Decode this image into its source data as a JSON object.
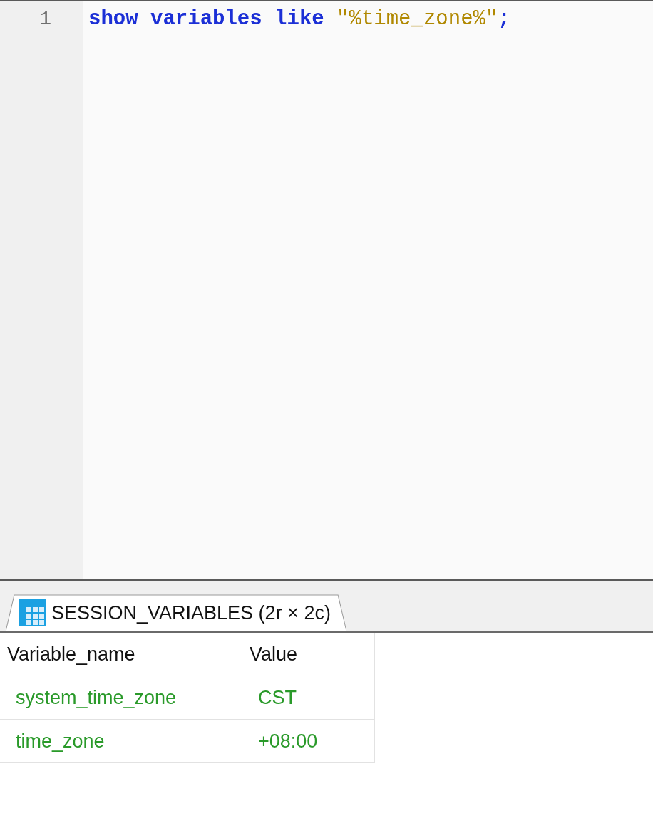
{
  "editor": {
    "lines": [
      {
        "number": "1",
        "tokens": [
          {
            "kind": "keyword",
            "text": "show"
          },
          {
            "kind": "keyword",
            "text": "variables"
          },
          {
            "kind": "keyword",
            "text": "like"
          },
          {
            "kind": "string",
            "text": "\"%time_zone%\""
          },
          {
            "kind": "punctuation",
            "text": ";"
          }
        ]
      }
    ]
  },
  "result_tabs": [
    {
      "label": "SESSION_VARIABLES (2r × 2c)",
      "selected": true
    }
  ],
  "table": {
    "columns": [
      "Variable_name",
      "Value"
    ],
    "rows": [
      [
        "system_time_zone",
        "CST"
      ],
      [
        "time_zone",
        "+08:00"
      ]
    ]
  }
}
